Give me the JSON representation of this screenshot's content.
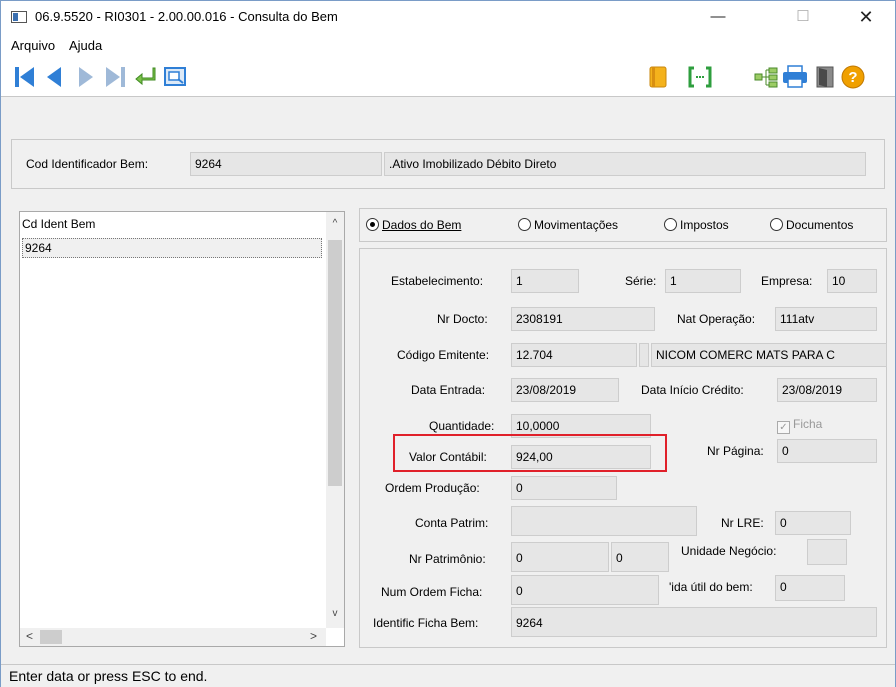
{
  "window": {
    "title": "06.9.5520 - RI0301 - 2.00.00.016 - Consulta do Bem",
    "minimize": "—",
    "maximize": "☐",
    "close": "✕"
  },
  "menu": {
    "items": [
      "Arquivo",
      "Ajuda"
    ]
  },
  "toolbar": {
    "left_icons": [
      "first-record-icon",
      "previous-record-icon",
      "next-record-icon",
      "last-record-icon",
      "return-icon",
      "zoom-icon"
    ],
    "right_icons": [
      "book-icon",
      "code-brackets-icon",
      "tree-icon",
      "print-icon",
      "exit-door-icon",
      "help-icon"
    ],
    "colors": {
      "nav_blue": "#2f7fd6",
      "nav_disabled": "#9fb9d8",
      "book_orange": "#e8a21a",
      "brackets_green": "#2e9e3e",
      "help_orange": "#f0a000"
    }
  },
  "header": {
    "cod_label": "Cod Identificador Bem:",
    "cod_value": "9264",
    "description": ".Ativo Imobilizado Débito Direto"
  },
  "list": {
    "column_header": "Cd Ident Bem",
    "rows": [
      "9264"
    ],
    "scroll_up": "^",
    "scroll_down": "v",
    "scroll_left": "<",
    "scroll_right": ">"
  },
  "tabs": [
    {
      "label": "Dados do Bem",
      "selected": true
    },
    {
      "label": "Movimentações",
      "selected": false
    },
    {
      "label": "Impostos",
      "selected": false
    },
    {
      "label": "Documentos",
      "selected": false
    }
  ],
  "fields": {
    "estabelecimento": {
      "label": "Estabelecimento:",
      "value": "1"
    },
    "serie": {
      "label": "Série:",
      "value": "1"
    },
    "empresa": {
      "label": "Empresa:",
      "value": "10"
    },
    "nr_docto": {
      "label": "Nr Docto:",
      "value": "2308191"
    },
    "nat_operacao": {
      "label": "Nat Operação:",
      "value": "111atv"
    },
    "codigo_emitente": {
      "label": "Código Emitente:",
      "value": "12.704",
      "extra": "",
      "name": "NICOM COMERC MATS PARA C"
    },
    "data_entrada": {
      "label": "Data Entrada:",
      "value": "23/08/2019"
    },
    "data_inicio_credito": {
      "label": "Data Início Crédito:",
      "value": "23/08/2019"
    },
    "quantidade": {
      "label": "Quantidade:",
      "value": "10,0000"
    },
    "ficha": {
      "label": "Ficha",
      "checked": true
    },
    "valor_contabil": {
      "label": "Valor Contábil:",
      "value": "924,00"
    },
    "nr_pagina": {
      "label": "Nr Página:",
      "value": "0"
    },
    "ordem_producao": {
      "label": "Ordem Produção:",
      "value": "0"
    },
    "conta_patrim": {
      "label": "Conta Patrim:",
      "value": ""
    },
    "nr_lre": {
      "label": "Nr LRE:",
      "value": "0"
    },
    "nr_patrimonio": {
      "label": "Nr Patrimônio:",
      "value": "0",
      "value2": "0"
    },
    "unidade_negocio": {
      "label": "Unidade Negócio:",
      "value": ""
    },
    "num_ordem_ficha": {
      "label": "Num Ordem Ficha:",
      "value": "0"
    },
    "vida_util": {
      "label": "'ida útil do bem:",
      "value": "0"
    },
    "identific_ficha_bem": {
      "label": "Identific Ficha Bem:",
      "value": "9264"
    }
  },
  "highlight_color": "#e0202a",
  "status": {
    "text": "Enter data or press ESC to end."
  }
}
